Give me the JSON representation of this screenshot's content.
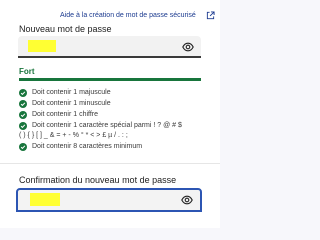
{
  "help_link": {
    "label": "Aide à la création de mot de passe sécurisé"
  },
  "new_password": {
    "label": "Nouveau mot de passe"
  },
  "strength": {
    "label": "Fort",
    "level": 1.0,
    "color": "#18753c"
  },
  "requirements": [
    {
      "text": "Doit contenir 1 majuscule",
      "met": true
    },
    {
      "text": "Doit contenir 1 minuscule",
      "met": true
    },
    {
      "text": "Doit contenir 1 chiffre",
      "met": true
    },
    {
      "text": "Doit contenir 1 caractère spécial parmi ! ? @ # $",
      "continuation": "( ) { } [ ] _ & = + - % ° * < > £ µ / . : ;",
      "met": true
    },
    {
      "text": "Doit contenir 8 caractères minimum",
      "met": true
    }
  ],
  "confirm_password": {
    "label": "Confirmation du nouveau mot de passe"
  },
  "colors": {
    "link": "#1b3a8f",
    "success": "#18753c",
    "focus": "#2c55b3"
  }
}
